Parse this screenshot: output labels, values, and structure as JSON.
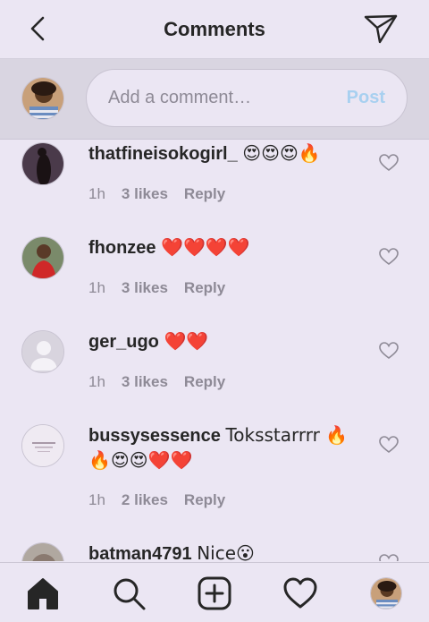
{
  "header": {
    "title": "Comments"
  },
  "composer": {
    "placeholder": "Add a comment…",
    "post_label": "Post"
  },
  "comments": [
    {
      "username": "thatfineisokogirl_",
      "text": "😍😍😍🔥",
      "time": "1h",
      "likes": "3 likes",
      "reply": "Reply"
    },
    {
      "username": "fhonzee",
      "text": "❤️❤️❤️❤️",
      "time": "1h",
      "likes": "3 likes",
      "reply": "Reply"
    },
    {
      "username": "ger_ugo",
      "text": "❤️❤️",
      "time": "1h",
      "likes": "3 likes",
      "reply": "Reply"
    },
    {
      "username": "bussysessence",
      "text": "Toksstarrrr 🔥🔥😍😍❤️❤️",
      "time": "1h",
      "likes": "2 likes",
      "reply": "Reply"
    },
    {
      "username": "batman4791",
      "text": "Nice😮",
      "time": "",
      "likes": "",
      "reply": ""
    }
  ],
  "nav": {
    "items": [
      "home-icon",
      "search-icon",
      "add-post-icon",
      "activity-heart-icon",
      "profile-avatar"
    ]
  },
  "colors": {
    "background": "#ebe6f3",
    "composer_bg": "#d9d5e1",
    "post_link": "#a8d0f0",
    "meta_text": "#8e8a96",
    "text": "#262626"
  }
}
